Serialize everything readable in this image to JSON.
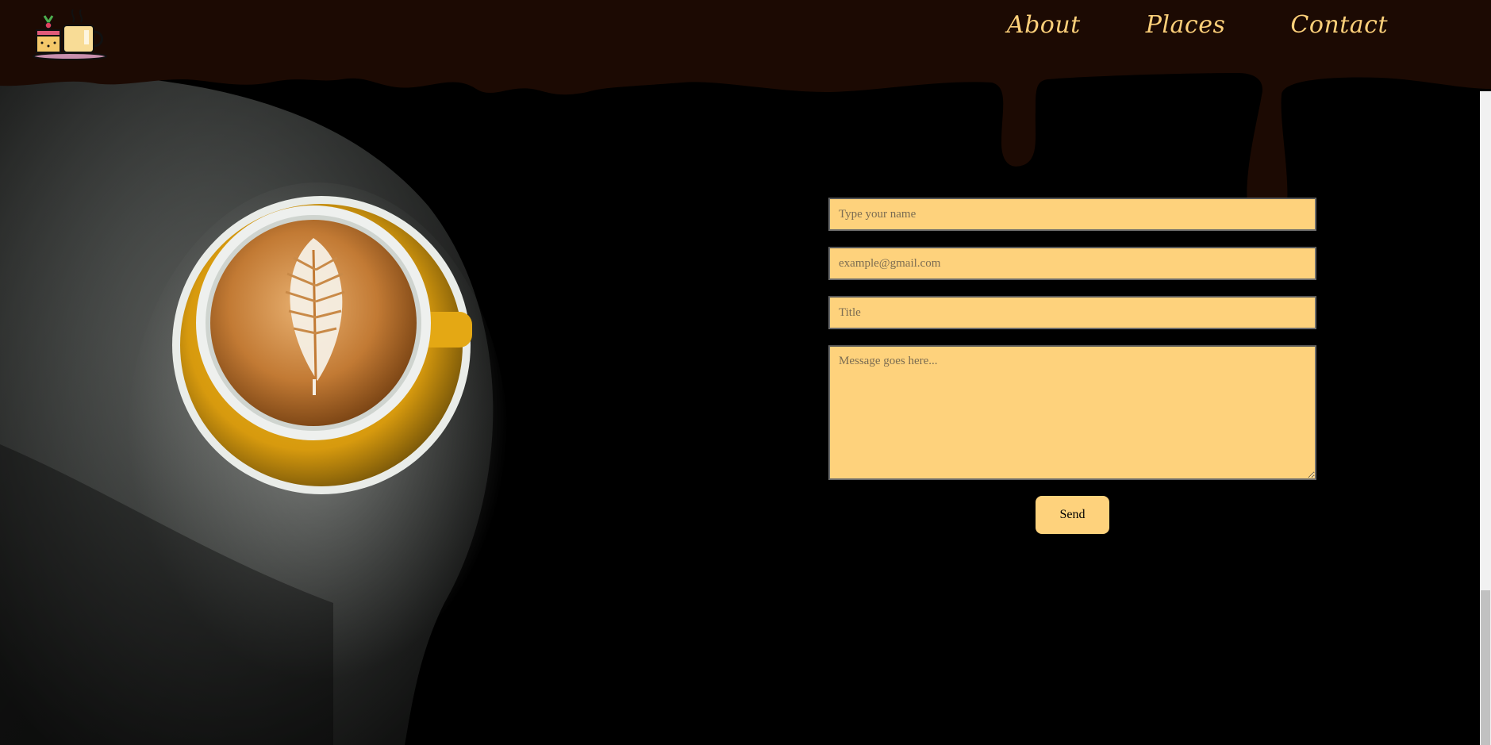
{
  "nav": {
    "items": [
      "About",
      "Places",
      "Contact"
    ]
  },
  "form": {
    "name_placeholder": "Type your name",
    "email_placeholder": "example@gmail.com",
    "title_placeholder": "Title",
    "message_placeholder": "Message goes here...",
    "send_label": "Send"
  },
  "colors": {
    "header_brown": "#1c0a03",
    "accent_yellow": "#fed27c",
    "background": "#000000"
  },
  "icons": {
    "logo": "cake-and-coffee-cup-icon"
  }
}
